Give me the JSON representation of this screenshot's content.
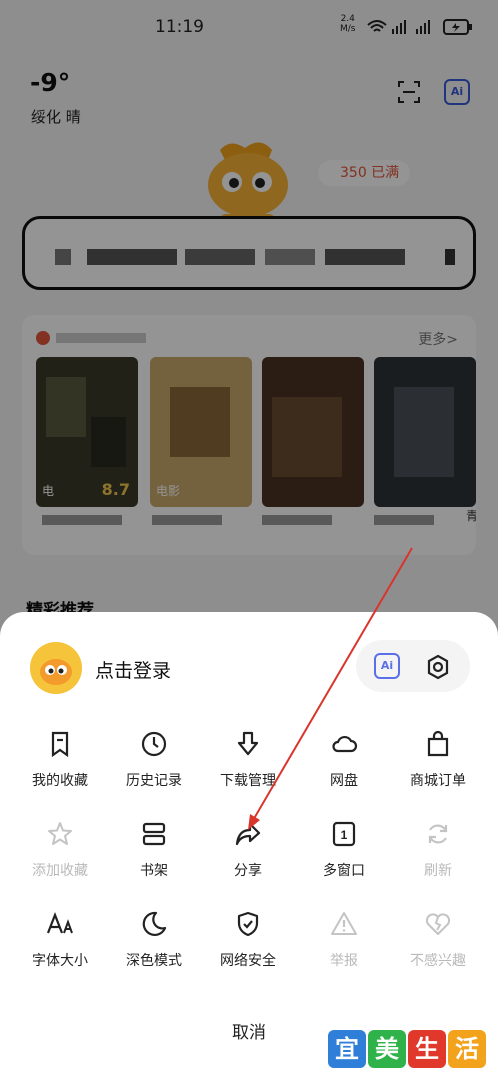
{
  "status_bar": {
    "time": "11:19",
    "net_speed": "2.4",
    "net_unit": "M/s"
  },
  "weather": {
    "temp": "-9°",
    "location": "绥化 晴"
  },
  "header": {
    "ai_label": "Ai"
  },
  "promo": {
    "text": "350 已满"
  },
  "movies": {
    "more": "更多>",
    "posters": [
      {
        "tag": "",
        "score": "8.7",
        "title_prefix": "电"
      },
      {
        "tag": "电影",
        "score": ""
      },
      {
        "tag": "",
        "score": ""
      },
      {
        "tag": "",
        "score": ""
      }
    ],
    "partial_char": "青"
  },
  "recommend_heading": "精彩推荐",
  "sheet": {
    "login_text": "点击登录",
    "ai_label": "Ai",
    "rows": [
      [
        {
          "label": "我的收藏",
          "icon": "bookmark-icon",
          "enabled": true
        },
        {
          "label": "历史记录",
          "icon": "clock-icon",
          "enabled": true
        },
        {
          "label": "下载管理",
          "icon": "download-icon",
          "enabled": true
        },
        {
          "label": "网盘",
          "icon": "cloud-icon",
          "enabled": true
        },
        {
          "label": "商城订单",
          "icon": "shopping-bag-icon",
          "enabled": true
        }
      ],
      [
        {
          "label": "添加收藏",
          "icon": "star-icon",
          "enabled": false
        },
        {
          "label": "书架",
          "icon": "bookshelf-icon",
          "enabled": true
        },
        {
          "label": "分享",
          "icon": "share-icon",
          "enabled": true
        },
        {
          "label": "多窗口",
          "icon": "window-count-icon",
          "enabled": true,
          "count": "1"
        },
        {
          "label": "刷新",
          "icon": "refresh-icon",
          "enabled": false
        }
      ],
      [
        {
          "label": "字体大小",
          "icon": "font-size-icon",
          "enabled": true
        },
        {
          "label": "深色模式",
          "icon": "moon-icon",
          "enabled": true
        },
        {
          "label": "网络安全",
          "icon": "shield-check-icon",
          "enabled": true
        },
        {
          "label": "举报",
          "icon": "warning-icon",
          "enabled": false
        },
        {
          "label": "不感兴趣",
          "icon": "broken-heart-icon",
          "enabled": false
        }
      ]
    ],
    "cancel": "取消"
  },
  "watermark": {
    "chars": [
      "宜",
      "美",
      "生",
      "活"
    ],
    "colors": [
      "#2f7fd8",
      "#2fb24a",
      "#e0392b",
      "#f2a21b"
    ]
  },
  "colors": {
    "accent_blue": "#5a6fe8",
    "annotation_red": "#d9352b",
    "disabled_gray": "#b9b9b9"
  }
}
